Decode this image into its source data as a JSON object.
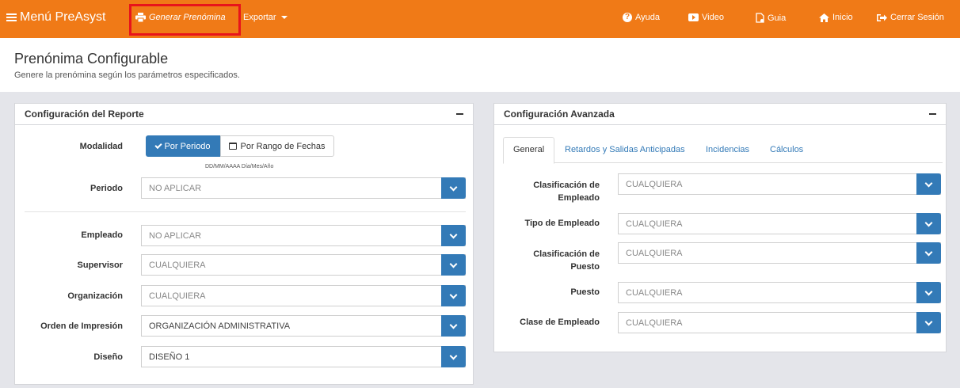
{
  "topbar": {
    "brand": "Menú PreAsyst",
    "generar": "Generar Prenómina",
    "exportar": "Exportar",
    "ayuda": "Ayuda",
    "video": "Video",
    "guia": "Guia",
    "inicio": "Inicio",
    "cerrar": "Cerrar Sesión",
    "color": "#f07a17"
  },
  "page": {
    "title": "Prenónima Configurable",
    "subtitle": "Genere la prenómina según los parámetros especificados."
  },
  "reporte": {
    "title": "Configuración del Reporte",
    "modalidad_label": "Modalidad",
    "btn_periodo": "Por Periodo",
    "btn_rango": "Por Rango de Fechas",
    "date_hint": "DD/MM/AAAA Día/Mes/Año",
    "fields": [
      {
        "label": "Periodo",
        "value": "NO APLICAR"
      },
      {
        "label": "Empleado",
        "value": "NO APLICAR"
      },
      {
        "label": "Supervisor",
        "value": "CUALQUIERA"
      },
      {
        "label": "Organización",
        "value": "CUALQUIERA"
      },
      {
        "label": "Orden de Impresión",
        "value": "ORGANIZACIÓN ADMINISTRATIVA"
      },
      {
        "label": "Diseño",
        "value": "DISEÑO 1"
      }
    ]
  },
  "avanzada": {
    "title": "Configuración Avanzada",
    "tabs": [
      "General",
      "Retardos y Salidas Anticipadas",
      "Incidencias",
      "Cálculos"
    ],
    "fields": [
      {
        "label_1": "Clasificación de",
        "label_2": "Empleado",
        "value": "CUALQUIERA"
      },
      {
        "label_1": "Tipo de Empleado",
        "value": "CUALQUIERA"
      },
      {
        "label_1": "Clasificación de",
        "label_2": "Puesto",
        "value": "CUALQUIERA"
      },
      {
        "label_1": "Puesto",
        "value": "CUALQUIERA"
      },
      {
        "label_1": "Clase de Empleado",
        "value": "CUALQUIERA"
      }
    ]
  },
  "accent": "#337ab7"
}
